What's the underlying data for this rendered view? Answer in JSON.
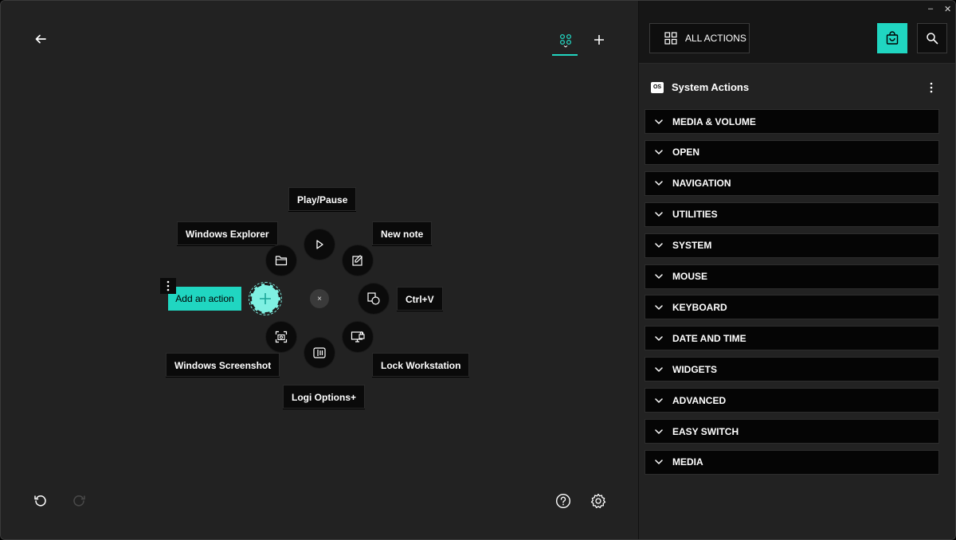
{
  "left": {
    "back_icon": "arrow-left-icon",
    "tabs": {
      "active_icon": "apps-grid-icon",
      "add_icon": "plus-icon"
    },
    "radial": {
      "top_label": "Play/Pause",
      "nodes": [
        {
          "name": "play-pause",
          "label": "Play/Pause",
          "icon": "play-icon"
        },
        {
          "name": "new-note",
          "label": "New note",
          "icon": "note-edit-icon"
        },
        {
          "name": "paste",
          "label": "Ctrl+V",
          "icon": "clipboard-paste-icon"
        },
        {
          "name": "lock-workstation",
          "label": "Lock Workstation",
          "icon": "monitor-lock-icon"
        },
        {
          "name": "logi-options",
          "label": "Logi Options+",
          "icon": "logi-options-icon"
        },
        {
          "name": "windows-screenshot",
          "label": "Windows Screenshot",
          "icon": "screenshot-icon"
        },
        {
          "name": "windows-explorer",
          "label": "Windows Explorer",
          "icon": "folder-icon"
        }
      ],
      "add_action_label": "Add an action",
      "center_close": "×"
    },
    "undo_icon": "undo-icon",
    "redo_icon": "redo-icon",
    "help_icon": "help-circle-icon",
    "settings_icon": "gear-icon"
  },
  "right": {
    "all_actions_label": "ALL ACTIONS",
    "os_badge": "OS",
    "section_title": "System Actions",
    "categories": [
      "MEDIA & VOLUME",
      "OPEN",
      "NAVIGATION",
      "UTILITIES",
      "SYSTEM",
      "MOUSE",
      "KEYBOARD",
      "DATE AND TIME",
      "WIDGETS",
      "ADVANCED",
      "EASY SWITCH",
      "MEDIA"
    ]
  },
  "window_controls": {
    "minimize": "–",
    "close": "✕"
  },
  "colors": {
    "accent": "#20d6c1",
    "background": "#222222",
    "panel_header": "#161616",
    "item_bg": "#050505"
  }
}
